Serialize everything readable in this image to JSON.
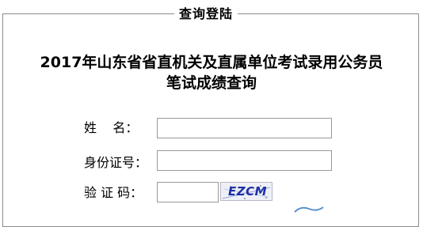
{
  "form": {
    "legend": "查询登陆",
    "title_line1": "2017年山东省省直机关及直属单位考试录用公务员",
    "title_line2": "笔试成绩查询",
    "fields": {
      "name_label": "姓    名：",
      "name_value": "",
      "id_label": "身份证号：",
      "id_value": "",
      "captcha_label": "验 证 码：",
      "captcha_value": ""
    },
    "captcha_image_text": "EZCM"
  }
}
